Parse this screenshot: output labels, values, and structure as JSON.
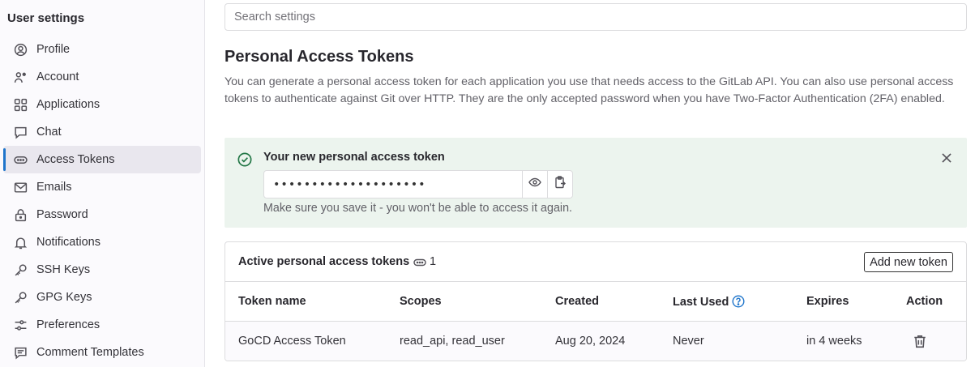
{
  "sidebar": {
    "title": "User settings",
    "items": [
      {
        "label": "Profile",
        "icon": "profile-icon"
      },
      {
        "label": "Account",
        "icon": "account-icon"
      },
      {
        "label": "Applications",
        "icon": "applications-icon"
      },
      {
        "label": "Chat",
        "icon": "chat-icon"
      },
      {
        "label": "Access Tokens",
        "icon": "token-icon",
        "active": true
      },
      {
        "label": "Emails",
        "icon": "email-icon"
      },
      {
        "label": "Password",
        "icon": "lock-icon"
      },
      {
        "label": "Notifications",
        "icon": "bell-icon"
      },
      {
        "label": "SSH Keys",
        "icon": "key-icon"
      },
      {
        "label": "GPG Keys",
        "icon": "key-icon"
      },
      {
        "label": "Preferences",
        "icon": "preferences-icon"
      },
      {
        "label": "Comment Templates",
        "icon": "comment-icon"
      }
    ]
  },
  "search": {
    "placeholder": "Search settings"
  },
  "page": {
    "title": "Personal Access Tokens",
    "description": "You can generate a personal access token for each application you use that needs access to the GitLab API. You can also use personal access tokens to authenticate against Git over HTTP. They are the only accepted password when you have Two-Factor Authentication (2FA) enabled."
  },
  "alert": {
    "title": "Your new personal access token",
    "token_masked": "••••••••••••••••••••",
    "hint": "Make sure you save it - you won't be able to access it again."
  },
  "tokens_card": {
    "title": "Active personal access tokens",
    "count": "1",
    "add_label": "Add new token",
    "columns": [
      "Token name",
      "Scopes",
      "Created",
      "Last Used",
      "Expires",
      "Action"
    ],
    "rows": [
      {
        "name": "GoCD Access Token",
        "scopes": "read_api, read_user",
        "created": "Aug 20, 2024",
        "last_used": "Never",
        "expires": "in 4 weeks"
      }
    ]
  },
  "colors": {
    "accent": "#1f75cb",
    "success_bg": "#ecf4ee",
    "success_icon": "#217645"
  }
}
